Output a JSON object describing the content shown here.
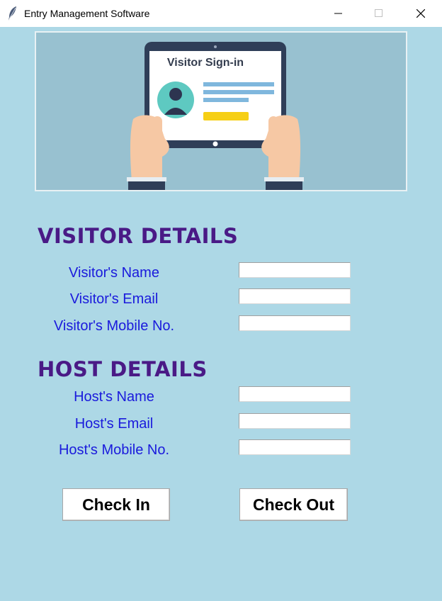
{
  "window": {
    "title": "Entry Management Software",
    "app_icon": "feather-icon"
  },
  "banner": {
    "illustration": "tablet-visitor-sign-in-illustration",
    "tablet_heading": "Visitor Sign-in"
  },
  "visitor": {
    "heading": "VISITOR DETAILS",
    "name_label": "Visitor's Name",
    "email_label": "Visitor's Email",
    "mobile_label": "Visitor's Mobile No.",
    "name_value": "",
    "email_value": "",
    "mobile_value": ""
  },
  "host": {
    "heading": "HOST DETAILS",
    "name_label": "Host's Name",
    "email_label": "Host's Email",
    "mobile_label": "Host's Mobile No.",
    "name_value": "",
    "email_value": "",
    "mobile_value": ""
  },
  "actions": {
    "check_in_label": "Check In",
    "check_out_label": "Check Out"
  },
  "colors": {
    "background": "#add8e6",
    "heading": "#4a1a86",
    "label": "#1a1adc"
  }
}
